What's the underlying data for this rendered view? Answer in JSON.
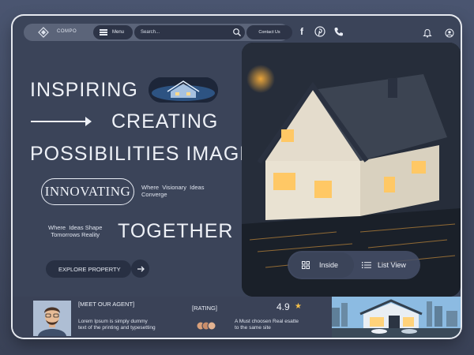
{
  "header": {
    "brand": "COMPO",
    "menu_label": "Menu",
    "search_placeholder": "Search...",
    "contact_label": "Contact Us",
    "social": [
      "facebook-icon",
      "pinterest-icon",
      "phone-icon"
    ]
  },
  "hero": {
    "line1": "INSPIRING",
    "line2": "CREATING",
    "line3": "POSSIBILITIES IMAGE",
    "innovating": "INNOVATING",
    "tagline1": "Where  Visionary  Ideas\nConverge",
    "tagline2": "Where  Ideas Shape\nTomorrows Reality",
    "together": "TOGETHER",
    "explore_label": "EXPLORE PROPERTY"
  },
  "view_toggle": {
    "inside_label": "Inside",
    "list_label": "List View"
  },
  "agent": {
    "title": "[MEET OUR AGENT]",
    "description": "Lorem Ipsum is simply dummy\ntext of the printing and typesetting"
  },
  "rating": {
    "title": "[RATING]",
    "value": "4.9",
    "description": "A Must choosen Real esatte\nto the same site"
  },
  "colors": {
    "background": "#4a5570",
    "panel": "#3b4459",
    "pill_dark": "#283043",
    "star": "#f5c04a"
  }
}
